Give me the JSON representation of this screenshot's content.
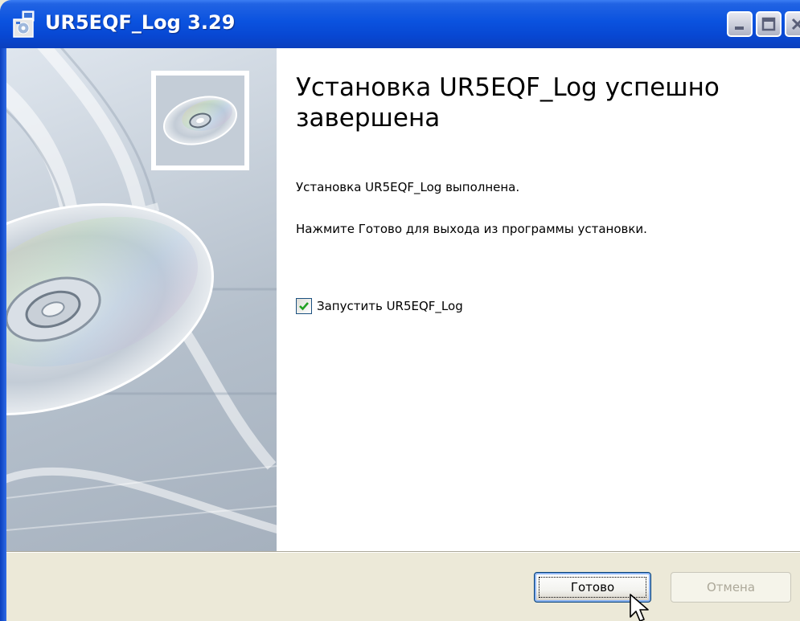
{
  "window": {
    "title": "UR5EQF_Log 3.29",
    "icon": "installer-icon"
  },
  "titlebar_buttons": {
    "minimize": "minimize-icon",
    "maximize": "maximize-icon",
    "close": "close-icon"
  },
  "content": {
    "heading": "Установка UR5EQF_Log успешно завершена",
    "line1": "Установка UR5EQF_Log выполнена.",
    "line2": "Нажмите Готово для выхода из программы установки.",
    "checkbox": {
      "label": "Запустить UR5EQF_Log",
      "checked": true
    }
  },
  "footer": {
    "finish_label": "Готово",
    "cancel_label": "Отмена",
    "cancel_enabled": false
  },
  "colors": {
    "titlebar": "#0a52df",
    "face": "#ece9d8",
    "disabled_text": "#aca899"
  }
}
